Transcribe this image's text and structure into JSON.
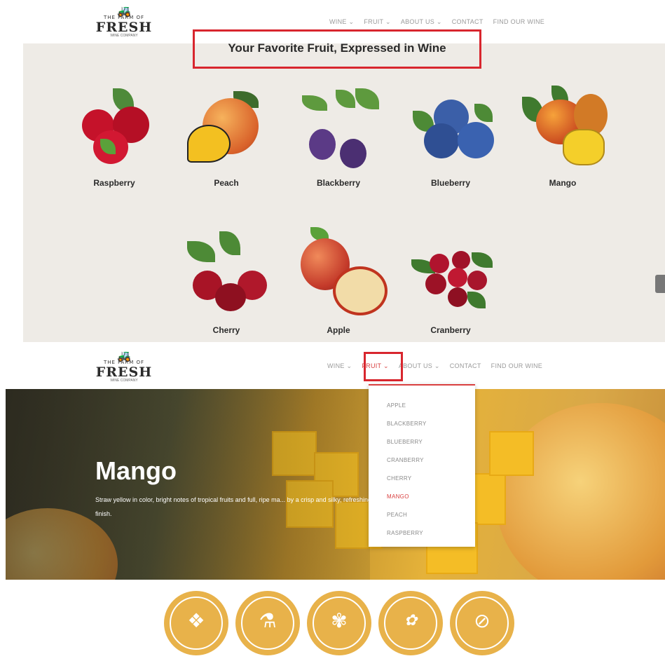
{
  "logo": {
    "line1": "THE FARM OF",
    "brand": "FRESH",
    "tagline": "WINE COMPANY"
  },
  "nav": {
    "items": [
      {
        "label": "WINE ⌄"
      },
      {
        "label": "FRUIT ⌄"
      },
      {
        "label": "ABOUT US ⌄"
      },
      {
        "label": "CONTACT"
      },
      {
        "label": "FIND OUR WINE"
      }
    ]
  },
  "fruit_section": {
    "title": "Your Favorite Fruit, Expressed in Wine",
    "fruits": [
      {
        "name": "Raspberry"
      },
      {
        "name": "Peach"
      },
      {
        "name": "Blackberry"
      },
      {
        "name": "Blueberry"
      },
      {
        "name": "Mango"
      },
      {
        "name": "Cherry"
      },
      {
        "name": "Apple"
      },
      {
        "name": "Cranberry"
      }
    ]
  },
  "hero": {
    "title": "Mango",
    "description": "Straw yellow in color, bright notes of tropical fruits and full, ripe ma... by a crisp and silky, refreshing finish."
  },
  "dropdown": {
    "items": [
      "APPLE",
      "BLACKBERRY",
      "BLUEBERRY",
      "CRANBERRY",
      "CHERRY",
      "MANGO",
      "PEACH",
      "RASPBERRY"
    ],
    "active": "MANGO"
  },
  "badges": [
    {
      "icon": "pineapple-icon"
    },
    {
      "icon": "fermentation-flask-icon"
    },
    {
      "icon": "wheat-icon"
    },
    {
      "icon": "vegan-icon"
    },
    {
      "icon": "no-sugar-icon"
    }
  ],
  "colors": {
    "highlight": "#d8262e",
    "accent": "#d94040",
    "badge": "#e8b24a",
    "section_bg": "#eeebe6"
  }
}
